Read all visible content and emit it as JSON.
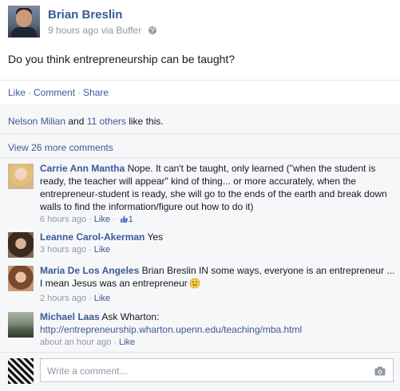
{
  "post": {
    "author": "Brian Breslin",
    "time": "9 hours ago",
    "via": "via Buffer",
    "text": "Do you think entrepreneurship can be taught?"
  },
  "actions": {
    "like": "Like",
    "comment": "Comment",
    "share": "Share",
    "separator": "·"
  },
  "likes": {
    "first_name": "Nelson Milian",
    "and_text": " and ",
    "others": "11 others",
    "suffix": " like this."
  },
  "view_more": "View 26 more comments",
  "comments": [
    {
      "author": "Carrie Ann Mantha",
      "text": "Nope. It can't be taught, only learned (\"when the student is ready, the teacher will appear\" kind of thing... or more accurately, when the entrepreneur-student is ready, she will go to the ends of the earth and break down walls to find the information/figure out how to do it)",
      "time": "6 hours ago",
      "like": "Like",
      "like_count": "1"
    },
    {
      "author": "Leanne Carol-Akerman",
      "text": "Yes",
      "time": "3 hours ago",
      "like": "Like"
    },
    {
      "author": "Maria De Los Angeles",
      "text": "Brian Breslin IN some ways, everyone is an entrepreneur ... I mean Jesus was an entrepreneur",
      "time": "2 hours ago",
      "like": "Like"
    },
    {
      "author": "Michael Laas",
      "text": "Ask Wharton:",
      "link": "http://entrepreneurship.wharton.upenn.edu/teaching/mba.html",
      "time": "about an hour ago",
      "like": "Like"
    }
  ],
  "composer": {
    "placeholder": "Write a comment..."
  },
  "icons": {
    "globe": "globe-icon",
    "thumbs_up": "thumbs-up-icon",
    "smiley": "smiley-icon",
    "camera": "camera-icon"
  },
  "colors": {
    "link_blue": "#3b5998",
    "meta_gray": "#9197a3",
    "panel_bg": "#f6f7f8"
  }
}
